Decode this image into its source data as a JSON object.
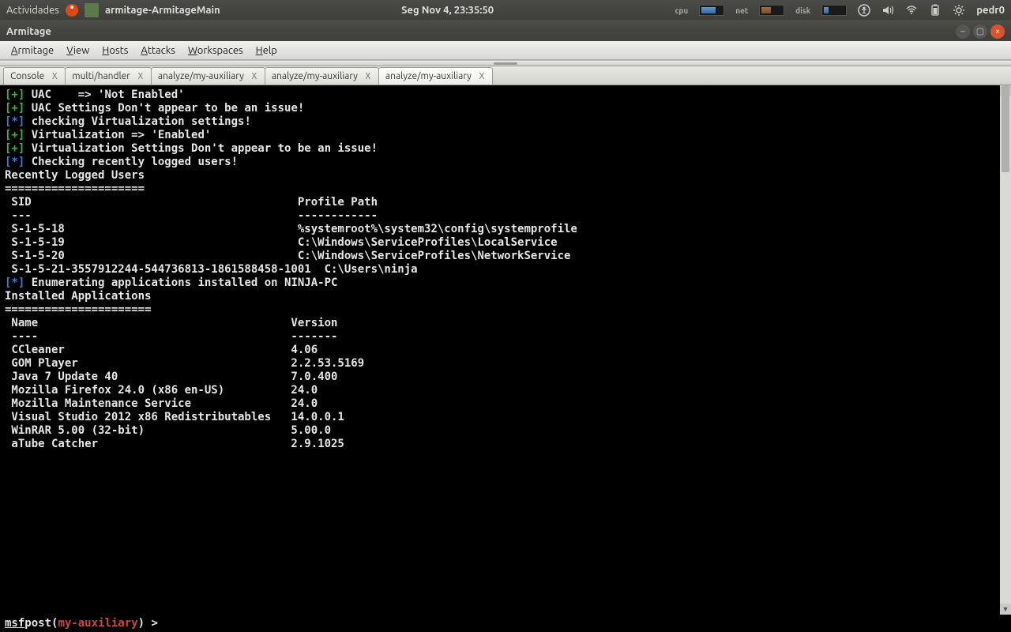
{
  "panel": {
    "activities": "Actividades",
    "active_app": "armitage-ArmitageMain",
    "clock": "Seg Nov  4, 23:35:50",
    "cpu_label": "cpu",
    "net_label": "net",
    "disk_label": "disk",
    "user": "pedr0"
  },
  "window": {
    "title": "Armitage"
  },
  "menu": {
    "items": [
      "Armitage",
      "View",
      "Hosts",
      "Attacks",
      "Workspaces",
      "Help"
    ]
  },
  "tabs": [
    {
      "label": "Console",
      "active": false
    },
    {
      "label": "multi/handler",
      "active": false
    },
    {
      "label": "analyze/my-auxiliary",
      "active": false
    },
    {
      "label": "analyze/my-auxiliary",
      "active": false
    },
    {
      "label": "analyze/my-auxiliary",
      "active": true
    }
  ],
  "console": {
    "lines": [
      {
        "prefix": "[+]",
        "prefix_color": "green",
        "text": "UAC    => 'Not Enabled'"
      },
      {
        "prefix": "[+]",
        "prefix_color": "green",
        "text": "UAC Settings Don't appear to be an issue!"
      },
      {
        "prefix": "",
        "text": ""
      },
      {
        "prefix": "[*]",
        "prefix_color": "blue",
        "text": "checking Virtualization settings!"
      },
      {
        "prefix": "[+]",
        "prefix_color": "green",
        "text": "Virtualization => 'Enabled'"
      },
      {
        "prefix": "[+]",
        "prefix_color": "green",
        "text": "Virtualization Settings Don't appear to be an issue!"
      },
      {
        "prefix": "",
        "text": ""
      },
      {
        "prefix": "[*]",
        "prefix_color": "blue",
        "text": "Checking recently logged users!"
      },
      {
        "prefix": "",
        "text": ""
      },
      {
        "raw": "Recently Logged Users",
        "class": "white"
      },
      {
        "raw": "=====================",
        "class": "white"
      },
      {
        "raw": ""
      },
      {
        "raw": " SID                                        Profile Path",
        "class": "white"
      },
      {
        "raw": " ---                                        ------------",
        "class": "white"
      },
      {
        "raw": " S-1-5-18                                   %systemroot%\\system32\\config\\systemprofile",
        "class": "white"
      },
      {
        "raw": " S-1-5-19                                   C:\\Windows\\ServiceProfiles\\LocalService",
        "class": "white"
      },
      {
        "raw": " S-1-5-20                                   C:\\Windows\\ServiceProfiles\\NetworkService",
        "class": "white"
      },
      {
        "raw": " S-1-5-21-3557912244-544736813-1861588458-1001  C:\\Users\\ninja",
        "class": "white"
      },
      {
        "raw": ""
      },
      {
        "raw": ""
      },
      {
        "prefix": "[*]",
        "prefix_color": "blue",
        "text": "Enumerating applications installed on NINJA-PC"
      },
      {
        "raw": ""
      },
      {
        "raw": "Installed Applications",
        "class": "white"
      },
      {
        "raw": "======================",
        "class": "white"
      },
      {
        "raw": ""
      },
      {
        "raw": " Name                                      Version",
        "class": "white"
      },
      {
        "raw": " ----                                      -------",
        "class": "white"
      },
      {
        "raw": " CCleaner                                  4.06",
        "class": "white"
      },
      {
        "raw": " GOM Player                                2.2.53.5169",
        "class": "white"
      },
      {
        "raw": " Java 7 Update 40                          7.0.400",
        "class": "white"
      },
      {
        "raw": " Mozilla Firefox 24.0 (x86 en-US)          24.0",
        "class": "white"
      },
      {
        "raw": " Mozilla Maintenance Service               24.0",
        "class": "white"
      },
      {
        "raw": " Visual Studio 2012 x86 Redistributables   14.0.0.1",
        "class": "white"
      },
      {
        "raw": " WinRAR 5.00 (32-bit)                      5.00.0",
        "class": "white"
      },
      {
        "raw": " aTube Catcher                             2.9.1025",
        "class": "white"
      },
      {
        "raw": ""
      }
    ],
    "prompt": {
      "msf": "msf",
      "pre": "  post(",
      "module": "my-auxiliary",
      "post": ") > "
    }
  }
}
